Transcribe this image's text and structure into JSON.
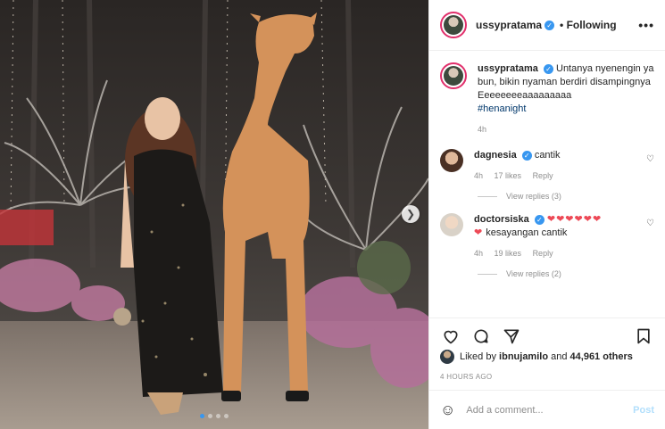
{
  "header": {
    "username": "ussypratama",
    "follow_status": "• Following",
    "more_icon": "more-dots-icon"
  },
  "caption": {
    "username": "ussypratama",
    "text": "Untanya nyenengin ya bun, bikin nyaman berdiri disampingnya Eeeeeeeeaaaaaaaaa",
    "hashtag": "#henanight",
    "time": "4h"
  },
  "comments": [
    {
      "username": "dagnesia",
      "text": "cantik",
      "time": "4h",
      "likes": "17 likes",
      "reply": "Reply",
      "view_replies": "View replies (3)"
    },
    {
      "username": "doctorsiska",
      "hearts_line1": "❤❤❤❤❤❤",
      "hearts_line2": "❤",
      "text": "kesayangan cantik",
      "time": "4h",
      "likes": "19 likes",
      "reply": "Reply",
      "view_replies": "View replies (2)"
    }
  ],
  "likes": {
    "prefix": "Liked by",
    "user": "ibnujamilo",
    "and": "and",
    "others": "44,961 others"
  },
  "timestamp": "4 HOURS AGO",
  "add_comment": {
    "placeholder": "Add a comment...",
    "post_label": "Post"
  },
  "carousel": {
    "slides": 4,
    "active": 1
  },
  "colors": {
    "verified": "#3897f0",
    "heart": "#ed4956",
    "link": "#00376b",
    "post_disabled": "#b2dffc"
  }
}
